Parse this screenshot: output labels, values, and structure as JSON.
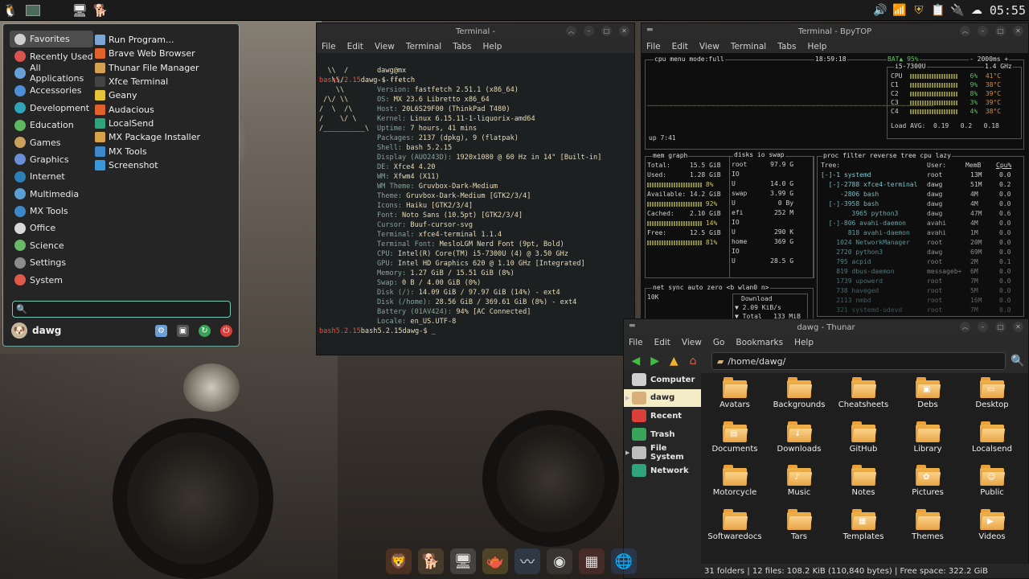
{
  "panel": {
    "clock": "05:55",
    "tray_icons": [
      "volume-icon",
      "network-icon",
      "shield-icon",
      "clipboard-icon",
      "power-icon",
      "weather-icon"
    ]
  },
  "menu": {
    "categories": [
      "Favorites",
      "Recently Used",
      "All Applications",
      "Accessories",
      "Development",
      "Education",
      "Games",
      "Graphics",
      "Internet",
      "Multimedia",
      "MX Tools",
      "Office",
      "Science",
      "Settings",
      "System"
    ],
    "category_colors": [
      "#cfcfcf",
      "#d9534f",
      "#6aa0d8",
      "#4d8fd6",
      "#2fa6b8",
      "#5fb85f",
      "#c9a15c",
      "#6a8fd8",
      "#2d7fb8",
      "#5c9fd6",
      "#3c88c8",
      "#d9d9d9",
      "#69b969",
      "#8c8c8c",
      "#e05a4a"
    ],
    "apps": [
      "Run Program...",
      "Brave Web Browser",
      "Thunar File Manager",
      "Xfce Terminal",
      "Geany",
      "Audacious",
      "LocalSend",
      "MX Package Installer",
      "MX Tools",
      "Screenshot"
    ],
    "app_colors": [
      "#7aa7d8",
      "#e0632b",
      "#d4a052",
      "#444444",
      "#e6c23a",
      "#e0612b",
      "#2fa37a",
      "#d6a24a",
      "#3c88c8",
      "#3a9ad9"
    ],
    "search_value": "",
    "user": "dawg"
  },
  "terminal": {
    "title": "Terminal -",
    "menu": [
      "File",
      "Edit",
      "View",
      "Terminal",
      "Tabs",
      "Help"
    ],
    "prompt_user": "bash5.2.15",
    "prompt_host": "dawg",
    "command": "ffetch",
    "ascii": [
      "  \\\\  /",
      "   \\\\/",
      "    \\\\",
      " /\\/ \\\\",
      "/  \\  /\\",
      "/    \\/ \\",
      "/__________\\"
    ],
    "header": "dawg@mx",
    "rule": "-------",
    "info": [
      [
        "Version",
        "fastfetch 2.51.1 (x86_64)"
      ],
      [
        "OS",
        "MX 23.6 Libretto x86_64"
      ],
      [
        "Host",
        "20L6S29F00 (ThinkPad T480)"
      ],
      [
        "Kernel",
        "Linux 6.15.11-1-liquorix-amd64"
      ],
      [
        "Uptime",
        "7 hours, 41 mins"
      ],
      [
        "Packages",
        "2137 (dpkg), 9 (flatpak)"
      ],
      [
        "Shell",
        "bash 5.2.15"
      ],
      [
        "Display (AUO243D)",
        "1920x1080 @ 60 Hz in 14\" [Built-in]"
      ],
      [
        "DE",
        "Xfce4 4.20"
      ],
      [
        "WM",
        "Xfwm4 (X11)"
      ],
      [
        "WM Theme",
        "Gruvbox-Dark-Medium"
      ],
      [
        "Theme",
        "Gruvbox-Dark-Medium [GTK2/3/4]"
      ],
      [
        "Icons",
        "Haiku [GTK2/3/4]"
      ],
      [
        "Font",
        "Noto Sans (10.5pt) [GTK2/3/4]"
      ],
      [
        "Cursor",
        "Buuf-cursor-svg"
      ],
      [
        "Terminal",
        "xfce4-terminal 1.1.4"
      ],
      [
        "Terminal Font",
        "MesloLGM Nerd Font (9pt, Bold)"
      ],
      [
        "CPU",
        "Intel(R) Core(TM) i5-7300U (4) @ 3.50 GHz"
      ],
      [
        "GPU",
        "Intel HD Graphics 620 @ 1.10 GHz [Integrated]"
      ],
      [
        "Memory",
        "1.27 GiB / 15.51 GiB (8%)"
      ],
      [
        "Swap",
        "0 B / 4.00 GiB (0%)"
      ],
      [
        "Disk (/)",
        "14.09 GiB / 97.97 GiB (14%) - ext4"
      ],
      [
        "Disk (/home)",
        "28.56 GiB / 369.61 GiB (8%) - ext4"
      ],
      [
        "Battery (01AV424)",
        "94% [AC Connected]"
      ],
      [
        "Locale",
        "en_US.UTF-8"
      ]
    ],
    "final_prompt": "bash5.2.15dawg-$ _"
  },
  "bpytop": {
    "title": "Terminal - BpyTOP",
    "menu": [
      "File",
      "Edit",
      "View",
      "Terminal",
      "Tabs",
      "Help"
    ],
    "cpu_header": "cpu  menu  mode:full",
    "time": "18:59:18",
    "bat": "BAT▲ 95%",
    "rate": "- 2000ms +",
    "cpu_name": "i5-7300U",
    "freq": "1.4 GHz",
    "cores": [
      [
        "CPU",
        "6%",
        "41°C"
      ],
      [
        "C1",
        "9%",
        "38°C"
      ],
      [
        "C2",
        "8%",
        "39°C"
      ],
      [
        "C3",
        "3%",
        "39°C"
      ],
      [
        "C4",
        "4%",
        "38°C"
      ]
    ],
    "load": "Load AVG:  0.19   0.2   0.18",
    "uptime": "up 7:41",
    "mem_tabs": "mem  graph",
    "mem": [
      [
        "Total:",
        "15.5 GiB"
      ],
      [
        "Used:",
        "1.28 GiB"
      ],
      [
        "",
        "8%"
      ],
      [
        "Available:",
        "14.2 GiB"
      ],
      [
        "",
        "92%"
      ],
      [
        "Cached:",
        "2.10 GiB"
      ],
      [
        "",
        "14%"
      ],
      [
        "Free:",
        "12.5 GiB"
      ],
      [
        "",
        "81%"
      ]
    ],
    "disks_tabs": "disks  io  swap",
    "disks": [
      [
        "root",
        "97.9 G"
      ],
      [
        "IO",
        ""
      ],
      [
        "U",
        "14.0 G"
      ],
      [
        "swap",
        "3.99 G"
      ],
      [
        "U",
        "0 By"
      ],
      [
        "efi",
        "252 M"
      ],
      [
        "IO",
        ""
      ],
      [
        "U",
        "290 K"
      ],
      [
        "home",
        "369 G"
      ],
      [
        "IO",
        ""
      ],
      [
        "U",
        "28.5 G"
      ]
    ],
    "proc_tabs": "proc  filter      reverse  tree   cpu lazy",
    "proc_head": [
      "Tree:",
      "User:",
      "MemB",
      "Cpu%"
    ],
    "procs": [
      [
        "[-]-1 systemd",
        "root",
        "13M",
        "0.0"
      ],
      [
        "  [-]-2788 xfce4-terminal",
        "dawg",
        "51M",
        "0.2"
      ],
      [
        "     -2806 bash",
        "dawg",
        "4M",
        "0.0"
      ],
      [
        "  [-]-3958 bash",
        "dawg",
        "4M",
        "0.0"
      ],
      [
        "        3965 python3",
        "dawg",
        "47M",
        "0.6"
      ],
      [
        "  [-]-806 avahi-daemon",
        "avahi",
        "4M",
        "0.0"
      ],
      [
        "       818 avahi-daemon",
        "avahi",
        "1M",
        "0.0"
      ],
      [
        "    1024 NetworkManager",
        "root",
        "20M",
        "0.0"
      ],
      [
        "    2720 python3",
        "dawg",
        "69M",
        "0.0"
      ],
      [
        "    795 acpid",
        "root",
        "2M",
        "0.1"
      ],
      [
        "    819 dbus-daemon",
        "messageb+",
        "6M",
        "0.0"
      ],
      [
        "    1739 upowerd",
        "root",
        "7M",
        "0.0"
      ],
      [
        "    738 haveged",
        "root",
        "5M",
        "0.0"
      ],
      [
        "    2113 nmbd",
        "root",
        "16M",
        "0.0"
      ],
      [
        "    321 systemd-udevd",
        "root",
        "7M",
        "0.0"
      ]
    ],
    "net_tabs": "net    sync  auto  zero  <b wlan0 n>",
    "net_scale": "10K",
    "download_label": "Download",
    "download_rate": "▼ 2.09 KiB/s",
    "download_total": "▼ Total   133 MiB"
  },
  "thunar": {
    "title": "dawg - Thunar",
    "menu": [
      "File",
      "Edit",
      "View",
      "Go",
      "Bookmarks",
      "Help"
    ],
    "path": "/home/dawg/",
    "places": [
      "Computer",
      "dawg",
      "Recent",
      "Trash",
      "File System",
      "Network"
    ],
    "place_colors": [
      "#cfcfcf",
      "#d8b077",
      "#d9403a",
      "#3aa35a",
      "#bdbdbd",
      "#2fa37a"
    ],
    "folders": [
      "Avatars",
      "Backgrounds",
      "Cheatsheets",
      "Debs",
      "Desktop",
      "Documents",
      "Downloads",
      "GitHub",
      "Library",
      "Localsend",
      "Motorcycle",
      "Music",
      "Notes",
      "Pictures",
      "Public",
      "Softwaredocs",
      "Tars",
      "Templates",
      "Themes",
      "Videos"
    ],
    "status": "31 folders  |  12 files: 108.2 KiB (110,840 bytes)  |  Free space: 322.2 GiB"
  },
  "dock": {
    "icons": [
      "lion-icon",
      "dog-icon",
      "computer-icon",
      "watering-can-icon",
      "browser-icon",
      "security-icon",
      "package-icon",
      "network-globe-icon"
    ],
    "colors": [
      "#e0702b",
      "#c99a5a",
      "#bdbdbd",
      "#e6c23a",
      "#4d8fd6",
      "#777777",
      "#c24a4a",
      "#3a7ad9"
    ]
  }
}
